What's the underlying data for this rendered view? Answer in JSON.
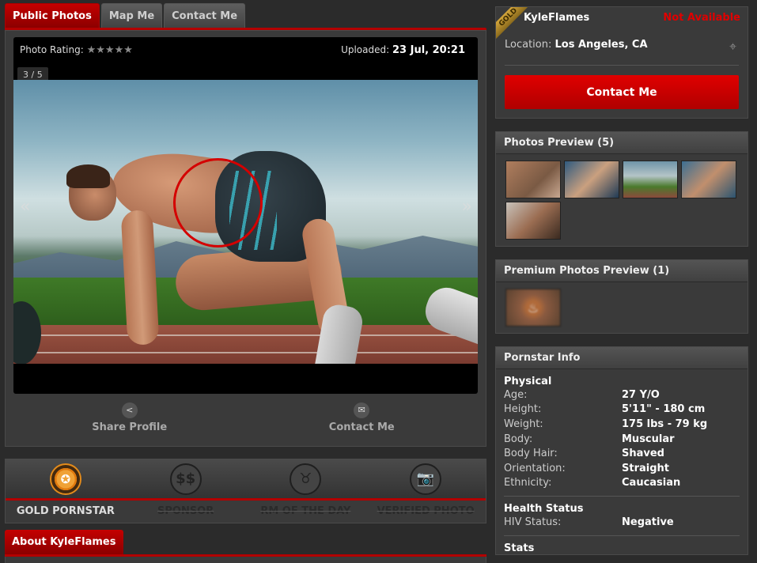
{
  "tabs": {
    "public_photos": "Public Photos",
    "map_me": "Map Me",
    "contact_me": "Contact Me"
  },
  "photo": {
    "rating_label": "Photo Rating:",
    "stars": "★★★★★",
    "uploaded_label": "Uploaded:",
    "uploaded_value": "23 Jul, 20:21",
    "counter": "3 / 5",
    "prev": "«",
    "next": "»"
  },
  "actions": {
    "share_label": "Share Profile",
    "contact_label": "Contact Me"
  },
  "badges": [
    {
      "label": "GOLD PORNSTAR",
      "icon": "gold-medal-icon",
      "active": true
    },
    {
      "label": "SPONSOR",
      "icon": "dollar-icon",
      "glyph": "$$",
      "active": false
    },
    {
      "label": "RM OF THE DAY",
      "icon": "devil-icon",
      "glyph": "♉",
      "active": false
    },
    {
      "label": "VERIFIED PHOTO",
      "icon": "camera-icon",
      "glyph": "📷",
      "active": false
    }
  ],
  "about": {
    "tab_label": "About KyleFlames"
  },
  "profile": {
    "ribbon": "GOLD",
    "username": "KyleFlames",
    "availability": "Not Available",
    "location_label": "Location:",
    "location_value": "Los Angeles, CA",
    "contact_button": "Contact Me"
  },
  "photos_preview": {
    "title": "Photos Preview (5)"
  },
  "premium_preview": {
    "title": "Premium Photos Preview (1)"
  },
  "pornstar_info": {
    "title": "Pornstar Info",
    "physical_title": "Physical",
    "physical": [
      {
        "key": "Age:",
        "value": "27 Y/O"
      },
      {
        "key": "Height:",
        "value": "5'11\" - 180 cm"
      },
      {
        "key": "Weight:",
        "value": "175 lbs - 79 kg"
      },
      {
        "key": "Body:",
        "value": "Muscular"
      },
      {
        "key": "Body Hair:",
        "value": "Shaved"
      },
      {
        "key": "Orientation:",
        "value": "Straight"
      },
      {
        "key": "Ethnicity:",
        "value": "Caucasian"
      }
    ],
    "health_title": "Health Status",
    "health": [
      {
        "key": "HIV Status:",
        "value": "Negative"
      }
    ],
    "stats_title": "Stats"
  },
  "colors": {
    "accent_red": "#b30000",
    "availability_red": "#e00000",
    "gold": "#e38b1b"
  }
}
